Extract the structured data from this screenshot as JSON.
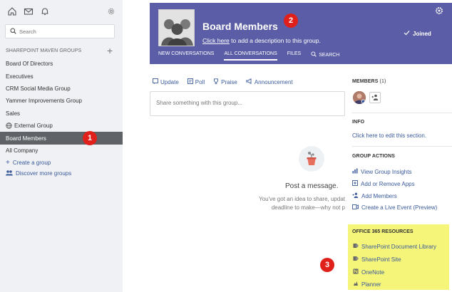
{
  "sidebar": {
    "search_placeholder": "Search",
    "groups_header": "SHAREPOINT MAVEN GROUPS",
    "groups": [
      "Board Of Directors",
      "Executives",
      "CRM Social Media Group",
      "Yammer Improvements Group",
      "Sales",
      "External Group",
      "Board Members",
      "All Company"
    ],
    "active_group": "Board Members",
    "create_group": "Create a group",
    "discover_groups": "Discover more groups"
  },
  "banner": {
    "title": "Board Members",
    "desc_link": "Click here",
    "desc_rest": " to add a description to this group.",
    "joined": "Joined",
    "nav": [
      "NEW CONVERSATIONS",
      "ALL CONVERSATIONS",
      "FILES",
      "SEARCH"
    ],
    "active_nav": "ALL CONVERSATIONS",
    "color": "#5b5ea6"
  },
  "composer": {
    "tabs": [
      "Update",
      "Poll",
      "Praise",
      "Announcement"
    ],
    "placeholder": "Share something with this group..."
  },
  "empty": {
    "title": "Post a message.",
    "line1": "You've got an idea to share, updat",
    "line2": "deadline to make—why not p"
  },
  "right_panel": {
    "members_header": "MEMBERS",
    "members_count": "(1)",
    "info_header": "INFO",
    "info_link": "Click here to edit this section.",
    "actions_header": "GROUP ACTIONS",
    "actions": [
      "View Group Insights",
      "Add or Remove Apps",
      "Add Members",
      "Create a Live Event (Preview)"
    ],
    "o365_header": "OFFICE 365 RESOURCES",
    "o365_items": [
      "SharePoint Document Library",
      "SharePoint Site",
      "OneNote",
      "Planner"
    ],
    "o365_color": "#f5f57a"
  },
  "badges": [
    "1",
    "2",
    "3"
  ],
  "badge_color": "#e0201b"
}
